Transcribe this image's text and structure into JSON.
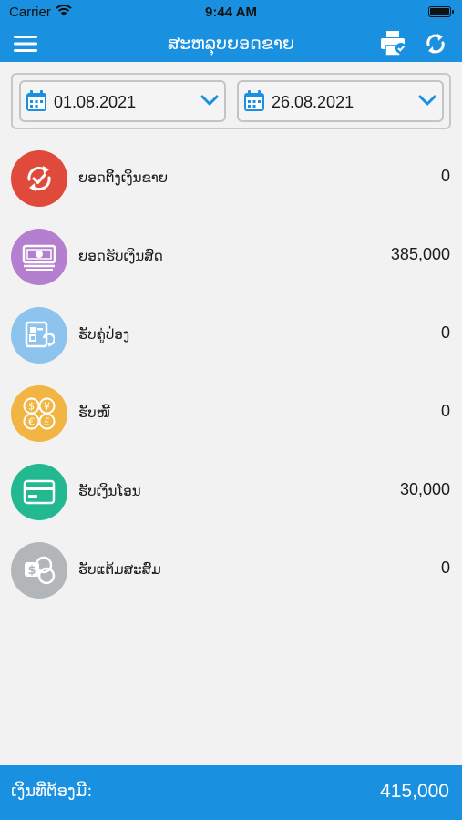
{
  "status_bar": {
    "carrier": "Carrier",
    "time": "9:44 AM"
  },
  "nav": {
    "title": "ສະຫລຸບຍອດຂາຍ",
    "icons": [
      "menu-icon",
      "print-icon",
      "refresh-icon"
    ]
  },
  "date_range": {
    "from": "01.08.2021",
    "to": "26.08.2021"
  },
  "rows": [
    {
      "label": "ຍອດຕິ້ງເງິນຂາຍ",
      "value": "0",
      "icon": "refund-cycle-icon",
      "color": "#e04a3a"
    },
    {
      "label": "ຍອດຮັບເງິນສົດ",
      "value": "385,000",
      "icon": "banknote-icon",
      "color": "#b57fd0"
    },
    {
      "label": "ຮັບຄູ່ປ່ອງ",
      "value": "0",
      "icon": "coupon-icon",
      "color": "#8cc4ee"
    },
    {
      "label": "ຮັບໜີ້",
      "value": "0",
      "icon": "currency-coins-icon",
      "color": "#f2b544"
    },
    {
      "label": "ຮັບເງິນໂອນ",
      "value": "30,000",
      "icon": "card-icon",
      "color": "#22b890"
    },
    {
      "label": "ຮັບແຕ້ມສະສົມ",
      "value": "0",
      "icon": "points-icon",
      "color": "#b3b6b8"
    }
  ],
  "footer": {
    "label": "ເງິນທີ່ຕ້ອງມີ:",
    "total": "415,000"
  },
  "colors": {
    "accent": "#1a90e0",
    "background": "#f2f2f2"
  }
}
